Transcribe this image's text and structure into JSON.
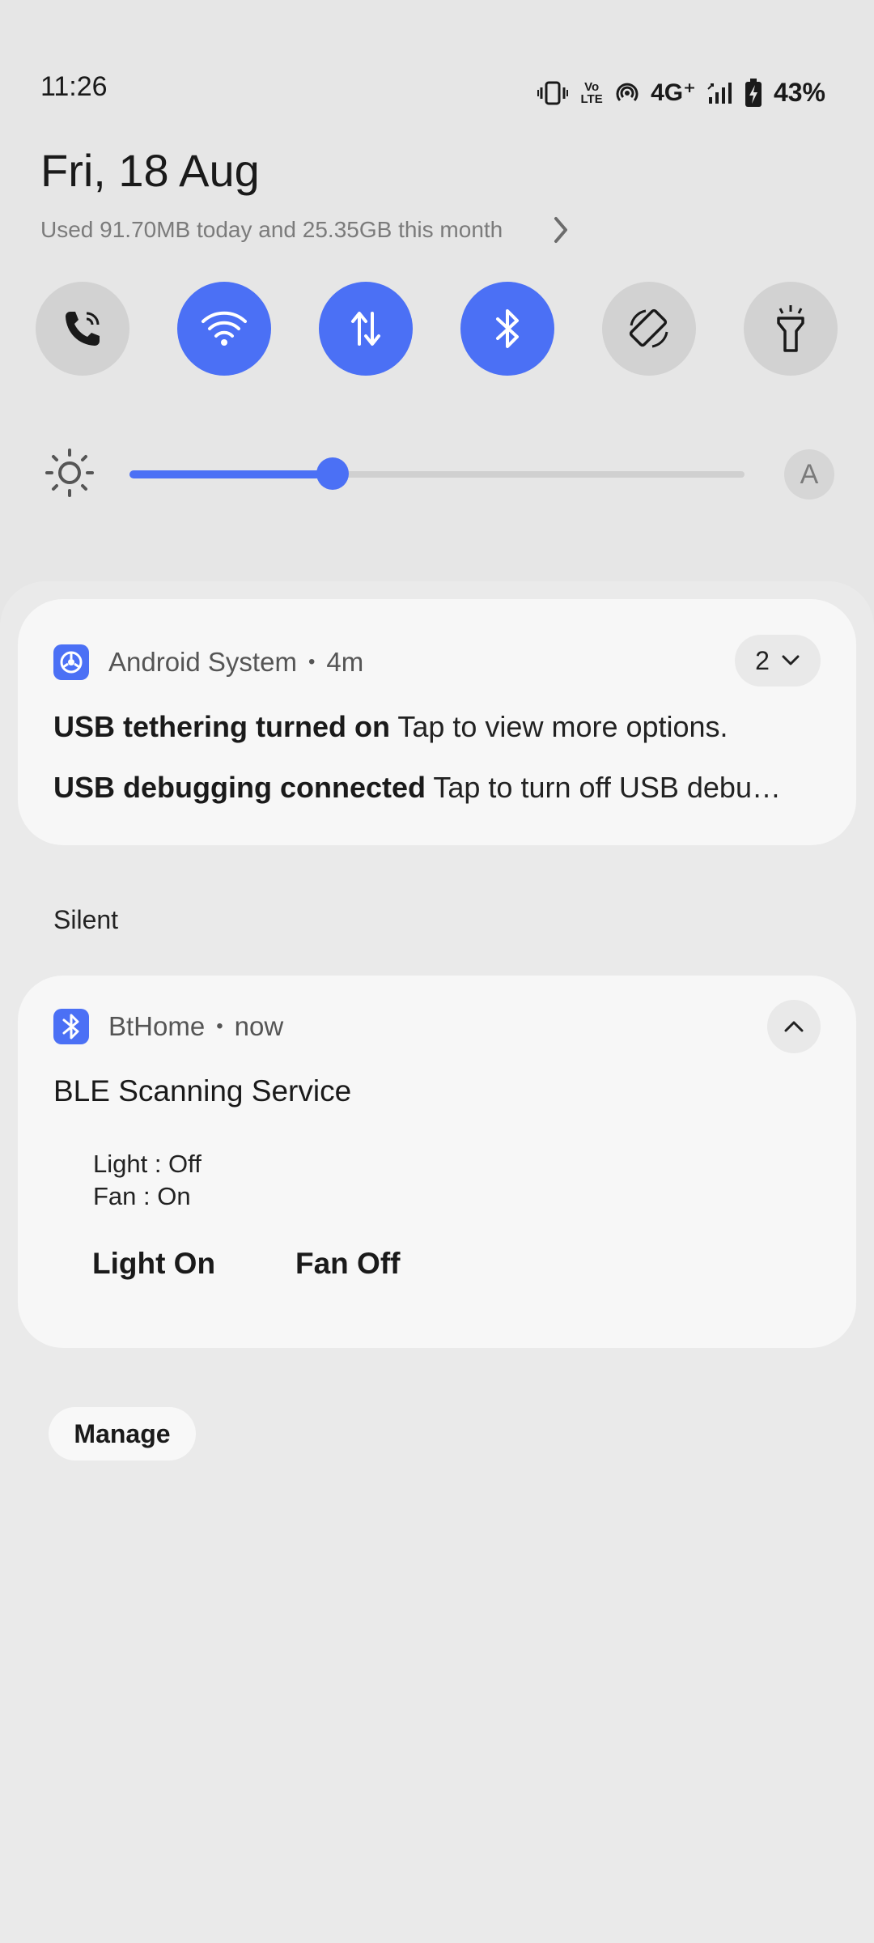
{
  "status_bar": {
    "time": "11:26",
    "network_label": "4G⁺",
    "volte_label": "Vo LTE",
    "battery_percent": "43%",
    "icons": [
      "vibrate-icon",
      "volte-icon",
      "hotspot-icon",
      "signal-icon",
      "battery-charging-icon"
    ]
  },
  "header": {
    "date": "Fri, 18 Aug",
    "data_usage": "Used 91.70MB today and 25.35GB this month"
  },
  "quick_tiles": [
    {
      "name": "calls",
      "icon": "phone-icon",
      "active": false
    },
    {
      "name": "wifi",
      "icon": "wifi-icon",
      "active": true
    },
    {
      "name": "mobile-data",
      "icon": "data-arrows-icon",
      "active": true
    },
    {
      "name": "bluetooth",
      "icon": "bluetooth-icon",
      "active": true
    },
    {
      "name": "auto-rotate",
      "icon": "rotate-icon",
      "active": false
    },
    {
      "name": "flashlight",
      "icon": "flashlight-icon",
      "active": false
    }
  ],
  "brightness": {
    "level": 0.33,
    "auto_label": "A"
  },
  "notifications": {
    "system": {
      "app_name": "Android System",
      "time": "4m",
      "count": "2",
      "lines": [
        {
          "title": "USB tethering turned on",
          "text": "Tap to view more options."
        },
        {
          "title": "USB debugging connected",
          "text": "Tap to turn off USB debu…"
        }
      ]
    },
    "section_label": "Silent",
    "bthome": {
      "app_name": "BtHome",
      "time": "now",
      "title": "BLE Scanning Service",
      "body_lines": [
        "Light : Off",
        "Fan : On"
      ],
      "actions": [
        "Light On",
        "Fan Off"
      ]
    }
  },
  "manage_label": "Manage",
  "colors": {
    "accent": "#4b70f5",
    "background": "#e6e6e6",
    "card": "#f7f7f7"
  }
}
